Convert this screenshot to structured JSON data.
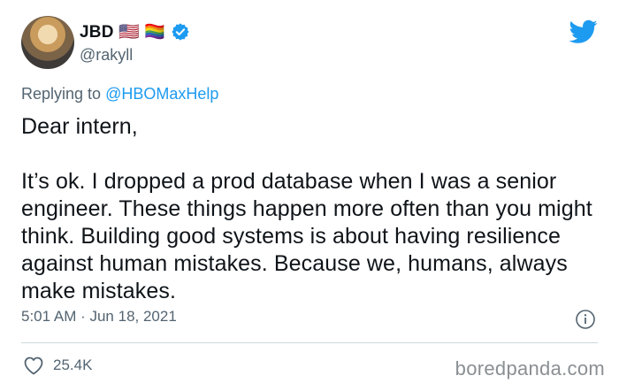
{
  "tweet": {
    "display_name": "JBD 🇺🇸 🏳️‍🌈",
    "handle": "@rakyll",
    "reply_prefix": "Replying to ",
    "reply_to": "@HBOMaxHelp",
    "text_lines": [
      "Dear intern,",
      "It’s ok. I dropped a prod database when I was a senior engineer. These things happen more often than you might think. Building good systems is about having resilience against human mistakes. Because we, humans, always make mistakes."
    ],
    "timestamp": "5:01 AM · Jun 18, 2021",
    "likes": "25.4K"
  },
  "watermark": "boredpanda.com",
  "colors": {
    "accent": "#1d9bf0",
    "secondary_text": "#536471",
    "divider": "#cfd9de"
  },
  "icons": [
    "avatar",
    "verified-badge-icon",
    "twitter-bird-icon",
    "info-icon",
    "heart-icon"
  ]
}
